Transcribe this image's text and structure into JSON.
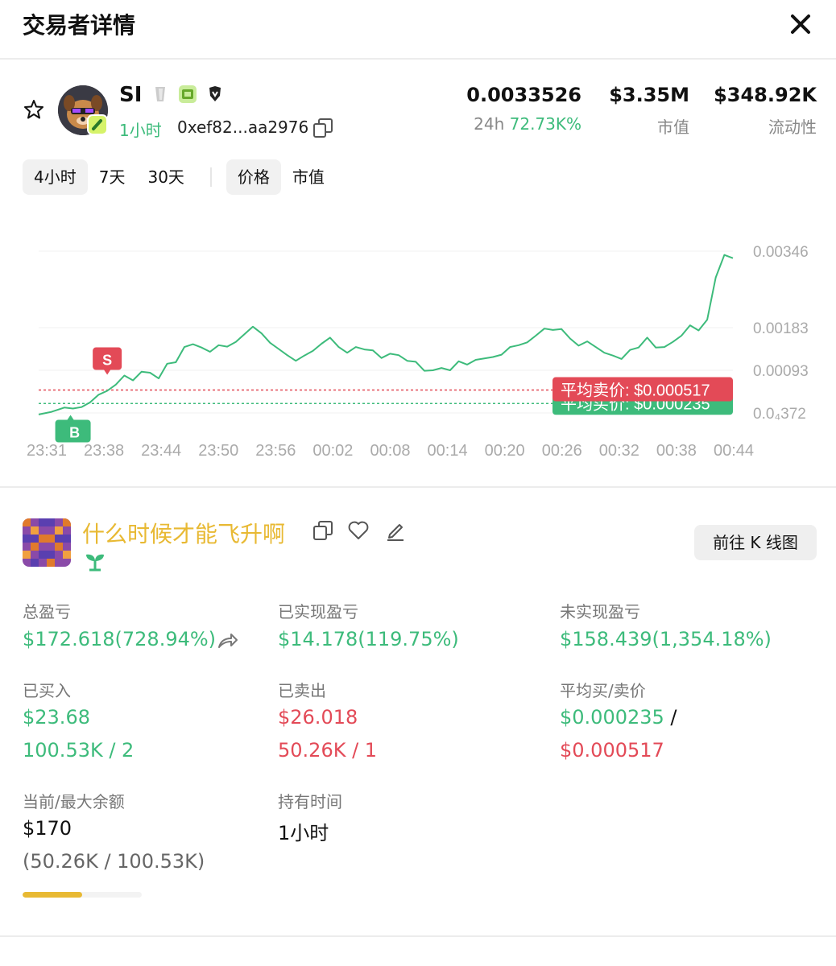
{
  "header": {
    "title": "交易者详情"
  },
  "token": {
    "symbol": "SI",
    "age": "1小时",
    "address": "0xef82...aa2976",
    "price": "0.0033526",
    "change_prefix": "24h",
    "change": "72.73K%",
    "market_cap": "$3.35M",
    "market_cap_label": "市值",
    "liquidity": "$348.92K",
    "liquidity_label": "流动性"
  },
  "tabs": {
    "range": [
      "4小时",
      "7天",
      "30天"
    ],
    "metric": [
      "价格",
      "市值"
    ],
    "active_range": "4小时",
    "active_metric": "价格"
  },
  "chart_data": {
    "type": "line",
    "x_ticks": [
      "23:31",
      "23:38",
      "23:44",
      "23:50",
      "23:56",
      "00:02",
      "00:08",
      "00:14",
      "00:20",
      "00:26",
      "00:32",
      "00:38",
      "00:44"
    ],
    "y_ticks": [
      {
        "value": 0.00346,
        "label": "0.00346"
      },
      {
        "value": 0.00183,
        "label": "0.00183"
      },
      {
        "value": 0.00093,
        "label": "0.00093"
      },
      {
        "value": 3.72e-05,
        "label": "0.0₄372"
      }
    ],
    "series": [
      {
        "color": "#3dbb7b",
        "points": [
          [
            0,
            3e-05
          ],
          [
            1.5,
            6e-05
          ],
          [
            3,
            0.00015
          ],
          [
            4,
            0.00013
          ],
          [
            5,
            0.00016
          ],
          [
            6,
            0.00026
          ],
          [
            7,
            0.00042
          ],
          [
            8,
            0.0005
          ],
          [
            9,
            0.00063
          ],
          [
            10,
            0.00082
          ],
          [
            11,
            0.00072
          ],
          [
            12,
            0.0009
          ],
          [
            13,
            0.00088
          ],
          [
            14,
            0.00076
          ],
          [
            15,
            0.00107
          ],
          [
            16,
            0.0011
          ],
          [
            17,
            0.00142
          ],
          [
            18,
            0.00148
          ],
          [
            19,
            0.00141
          ],
          [
            20,
            0.00132
          ],
          [
            21,
            0.00146
          ],
          [
            22,
            0.00143
          ],
          [
            23,
            0.00153
          ],
          [
            24,
            0.00169
          ],
          [
            25,
            0.00185
          ],
          [
            26,
            0.00171
          ],
          [
            27,
            0.00151
          ],
          [
            28,
            0.00138
          ],
          [
            29,
            0.00125
          ],
          [
            30,
            0.00113
          ],
          [
            31,
            0.00124
          ],
          [
            32,
            0.00134
          ],
          [
            33,
            0.00149
          ],
          [
            34,
            0.00162
          ],
          [
            35,
            0.00142
          ],
          [
            36,
            0.0013
          ],
          [
            37,
            0.00142
          ],
          [
            38,
            0.00137
          ],
          [
            39,
            0.00135
          ],
          [
            40,
            0.00119
          ],
          [
            41,
            0.00128
          ],
          [
            42,
            0.00125
          ],
          [
            43,
            0.00113
          ],
          [
            44,
            0.00111
          ],
          [
            45,
            0.00092
          ],
          [
            46,
            0.00093
          ],
          [
            47,
            0.00098
          ],
          [
            48,
            0.00093
          ],
          [
            49,
            0.00112
          ],
          [
            50,
            0.00105
          ],
          [
            51,
            0.00115
          ],
          [
            52,
            0.00118
          ],
          [
            53,
            0.00121
          ],
          [
            54,
            0.00126
          ],
          [
            55,
            0.00142
          ],
          [
            56,
            0.00146
          ],
          [
            57,
            0.00152
          ],
          [
            58,
            0.00166
          ],
          [
            59,
            0.00181
          ],
          [
            60,
            0.00178
          ],
          [
            61,
            0.0018
          ],
          [
            62,
            0.0016
          ],
          [
            63,
            0.00145
          ],
          [
            64,
            0.00154
          ],
          [
            65,
            0.00142
          ],
          [
            66,
            0.0013
          ],
          [
            67,
            0.00124
          ],
          [
            68,
            0.00117
          ],
          [
            69,
            0.00136
          ],
          [
            70,
            0.00141
          ],
          [
            71,
            0.00162
          ],
          [
            72,
            0.00141
          ],
          [
            73,
            0.00142
          ],
          [
            74,
            0.00153
          ],
          [
            75,
            0.00166
          ],
          [
            76,
            0.00188
          ],
          [
            77,
            0.00177
          ],
          [
            78,
            0.002
          ],
          [
            79,
            0.0029
          ],
          [
            80,
            0.00338
          ],
          [
            81,
            0.00331
          ]
        ]
      }
    ],
    "markers": [
      {
        "label": "S",
        "type": "sell",
        "x": 8,
        "y": 0.0005
      },
      {
        "label": "B",
        "type": "buy",
        "x": 4,
        "y": 0.00013
      }
    ],
    "avg_sell": {
      "label": "平均卖价: $0.000517",
      "value": 0.000517
    },
    "avg_buy": {
      "label": "平均买价: $0.000235",
      "value": 0.000235
    }
  },
  "wallet": {
    "name": "什么时候才能飞升啊",
    "kline_button": "前往 K 线图"
  },
  "metrics": {
    "total_pnl_label": "总盈亏",
    "total_pnl": "$172.618(728.94%)",
    "realized_label": "已实现盈亏",
    "realized": "$14.178(119.75%)",
    "unrealized_label": "未实现盈亏",
    "unrealized": "$158.439(1,354.18%)",
    "bought_label": "已买入",
    "bought": "$23.68",
    "bought_qty": "100.53K / 2",
    "sold_label": "已卖出",
    "sold": "$26.018",
    "sold_qty": "50.26K / 1",
    "avg_label": "平均买/卖价",
    "avg_buy": "$0.000235",
    "avg_sep": " /",
    "avg_sell": "$0.000517",
    "balance_label": "当前/最大余额",
    "balance": "$170",
    "balance_detail": "(50.26K / 100.53K)",
    "balance_fraction": 0.5,
    "hold_label": "持有时间",
    "hold": "1小时"
  },
  "colors": {
    "green": "#3dbb7b",
    "red": "#e34a57",
    "accent": "#e8b933"
  }
}
